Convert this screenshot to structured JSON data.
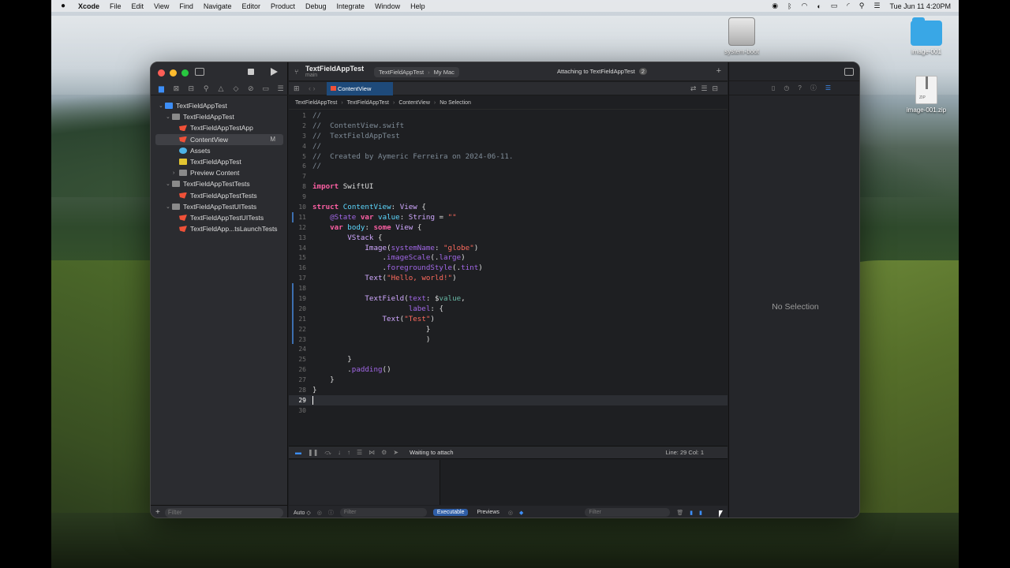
{
  "menubar": {
    "app": "Xcode",
    "items": [
      "File",
      "Edit",
      "View",
      "Find",
      "Navigate",
      "Editor",
      "Product",
      "Debug",
      "Integrate",
      "Window",
      "Help"
    ],
    "clock": "Tue Jun 11  4:20PM"
  },
  "desktop": {
    "icons": [
      {
        "label": "system-boot",
        "kind": "disk-icon"
      },
      {
        "label": "image-001",
        "kind": "folder-icon"
      },
      {
        "label": "image-001.zip",
        "kind": "zip-icon",
        "zip_text": "ZIP"
      }
    ]
  },
  "toolbar": {
    "project_title": "TextFieldAppTest",
    "branch": "main",
    "scheme": "TextFieldAppTest",
    "destination": "My Mac",
    "status": "Attaching to TextFieldAppTest",
    "status_count": "2"
  },
  "tab": {
    "label": "ContentView"
  },
  "breadcrumb": [
    "TextFieldAppTest",
    "TextFieldAppTest",
    "ContentView",
    "No Selection"
  ],
  "navigator": {
    "items": [
      {
        "label": "TextFieldAppTest",
        "type": "proj",
        "indent": 0,
        "chev": "⌄"
      },
      {
        "label": "TextFieldAppTest",
        "type": "fold",
        "indent": 1,
        "chev": "⌄"
      },
      {
        "label": "TextFieldAppTestApp",
        "type": "swift",
        "indent": 2,
        "chev": ""
      },
      {
        "label": "ContentView",
        "type": "swift",
        "indent": 2,
        "chev": "",
        "badge": "M",
        "selected": true
      },
      {
        "label": "Assets",
        "type": "asset",
        "indent": 2,
        "chev": ""
      },
      {
        "label": "TextFieldAppTest",
        "type": "app",
        "indent": 2,
        "chev": ""
      },
      {
        "label": "Preview Content",
        "type": "fold",
        "indent": 2,
        "chev": "›"
      },
      {
        "label": "TextFieldAppTestTests",
        "type": "fold",
        "indent": 1,
        "chev": "⌄"
      },
      {
        "label": "TextFieldAppTestTests",
        "type": "swift",
        "indent": 2,
        "chev": ""
      },
      {
        "label": "TextFieldAppTestUITests",
        "type": "fold",
        "indent": 1,
        "chev": "⌄"
      },
      {
        "label": "TextFieldAppTestUITests",
        "type": "swift",
        "indent": 2,
        "chev": ""
      },
      {
        "label": "TextFieldApp...tsLaunchTests",
        "type": "swift",
        "indent": 2,
        "chev": ""
      }
    ],
    "filter_placeholder": "Filter"
  },
  "code": {
    "current_line": 29,
    "lines": [
      [
        [
          "cm",
          "//"
        ]
      ],
      [
        [
          "cm",
          "//  ContentView.swift"
        ]
      ],
      [
        [
          "cm",
          "//  TextFieldAppTest"
        ]
      ],
      [
        [
          "cm",
          "//"
        ]
      ],
      [
        [
          "cm",
          "//  Created by Aymeric Ferreira on 2024-06-11."
        ]
      ],
      [
        [
          "cm",
          "//"
        ]
      ],
      [],
      [
        [
          "kw",
          "import"
        ],
        [
          "txt",
          " SwiftUI"
        ]
      ],
      [],
      [
        [
          "kw",
          "struct"
        ],
        [
          "txt",
          " "
        ],
        [
          "tyd",
          "ContentView"
        ],
        [
          "txt",
          ": "
        ],
        [
          "ty",
          "View"
        ],
        [
          "txt",
          " {"
        ]
      ],
      [
        [
          "txt",
          "    "
        ],
        [
          "fn",
          "@State"
        ],
        [
          "txt",
          " "
        ],
        [
          "kw",
          "var"
        ],
        [
          "txt",
          " "
        ],
        [
          "tyd",
          "value"
        ],
        [
          "txt",
          ": "
        ],
        [
          "ty",
          "String"
        ],
        [
          "txt",
          " = "
        ],
        [
          "st",
          "\"\""
        ]
      ],
      [
        [
          "txt",
          "    "
        ],
        [
          "kw",
          "var"
        ],
        [
          "txt",
          " "
        ],
        [
          "tyd",
          "body"
        ],
        [
          "txt",
          ": "
        ],
        [
          "kw",
          "some"
        ],
        [
          "txt",
          " "
        ],
        [
          "ty",
          "View"
        ],
        [
          "txt",
          " {"
        ]
      ],
      [
        [
          "txt",
          "        "
        ],
        [
          "ty",
          "VStack"
        ],
        [
          "txt",
          " {"
        ]
      ],
      [
        [
          "txt",
          "            "
        ],
        [
          "ty",
          "Image"
        ],
        [
          "txt",
          "("
        ],
        [
          "fn",
          "systemName"
        ],
        [
          "txt",
          ": "
        ],
        [
          "st",
          "\"globe\""
        ],
        [
          "txt",
          ")"
        ]
      ],
      [
        [
          "txt",
          "                ."
        ],
        [
          "fn",
          "imageScale"
        ],
        [
          "txt",
          "(."
        ],
        [
          "fn",
          "large"
        ],
        [
          "txt",
          ")"
        ]
      ],
      [
        [
          "txt",
          "                ."
        ],
        [
          "fn",
          "foregroundStyle"
        ],
        [
          "txt",
          "(."
        ],
        [
          "fn",
          "tint"
        ],
        [
          "txt",
          ")"
        ]
      ],
      [
        [
          "txt",
          "            "
        ],
        [
          "ty",
          "Text"
        ],
        [
          "txt",
          "("
        ],
        [
          "st",
          "\"Hello, world!\""
        ],
        [
          "txt",
          ")"
        ]
      ],
      [],
      [
        [
          "txt",
          "            "
        ],
        [
          "ty",
          "TextField"
        ],
        [
          "txt",
          "("
        ],
        [
          "fn",
          "text"
        ],
        [
          "txt",
          ": $"
        ],
        [
          "prop",
          "value"
        ],
        [
          "txt",
          ","
        ]
      ],
      [
        [
          "txt",
          "                      "
        ],
        [
          "fn",
          "label"
        ],
        [
          "txt",
          ": {"
        ]
      ],
      [
        [
          "txt",
          "                "
        ],
        [
          "ty",
          "Text"
        ],
        [
          "txt",
          "("
        ],
        [
          "st",
          "\"Test\""
        ],
        [
          "txt",
          ")"
        ]
      ],
      [
        [
          "txt",
          "                          }"
        ]
      ],
      [
        [
          "txt",
          "                          )"
        ]
      ],
      [],
      [
        [
          "txt",
          "        }"
        ]
      ],
      [
        [
          "txt",
          "        ."
        ],
        [
          "fn",
          "padding"
        ],
        [
          "txt",
          "()"
        ]
      ],
      [
        [
          "txt",
          "    }"
        ]
      ],
      [
        [
          "txt",
          "}"
        ]
      ],
      [],
      []
    ],
    "changed_lines": [
      11,
      18,
      19,
      20,
      21,
      22,
      23
    ]
  },
  "debug": {
    "status": "Waiting to attach",
    "position": "Line: 29  Col: 1",
    "auto": "Auto ◇",
    "filter_placeholder": "Filter",
    "executable": "Executable",
    "previews": "Previews",
    "filter2_placeholder": "Filter"
  },
  "inspector": {
    "empty_text": "No Selection"
  }
}
